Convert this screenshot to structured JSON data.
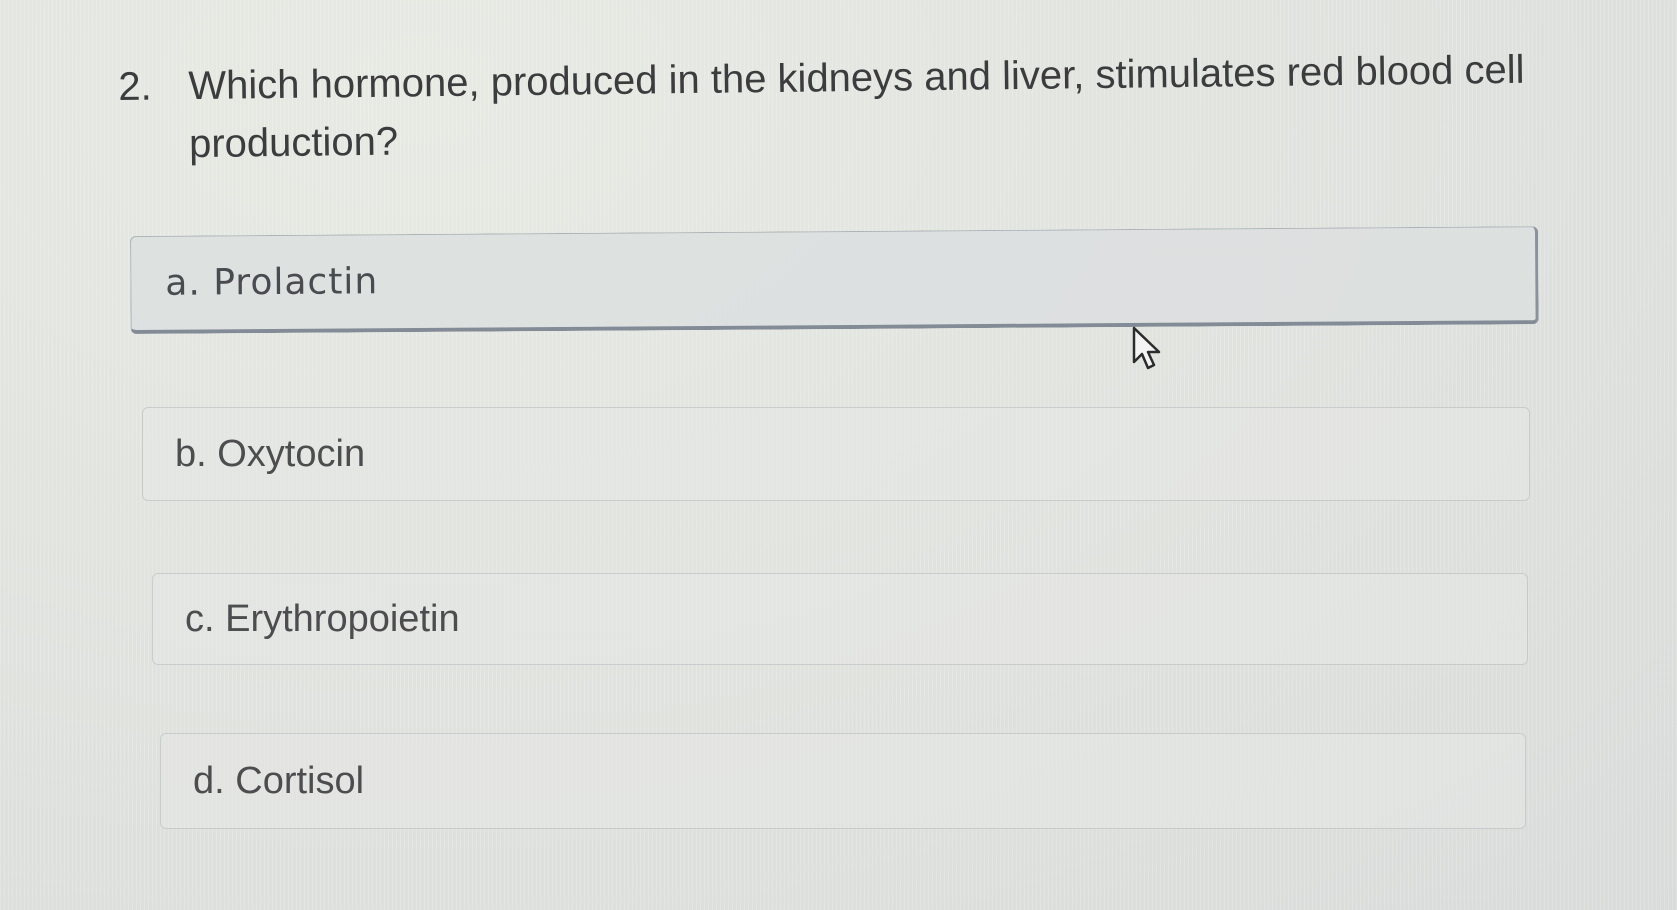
{
  "question": {
    "number": "2.",
    "text": "Which hormone, produced in the kidneys and liver, stimulates red blood cell production?"
  },
  "options": [
    {
      "label": "a. Prolactin",
      "selected": true
    },
    {
      "label": "b. Oxytocin",
      "selected": false
    },
    {
      "label": "c. Erythropoietin",
      "selected": false
    },
    {
      "label": "d. Cortisol",
      "selected": false
    }
  ],
  "icons": {
    "cursor": "arrow-pointer-icon"
  },
  "colors": {
    "background": "#e6e8e4",
    "text": "#3c3c3e",
    "selected_border": "#828b96"
  }
}
